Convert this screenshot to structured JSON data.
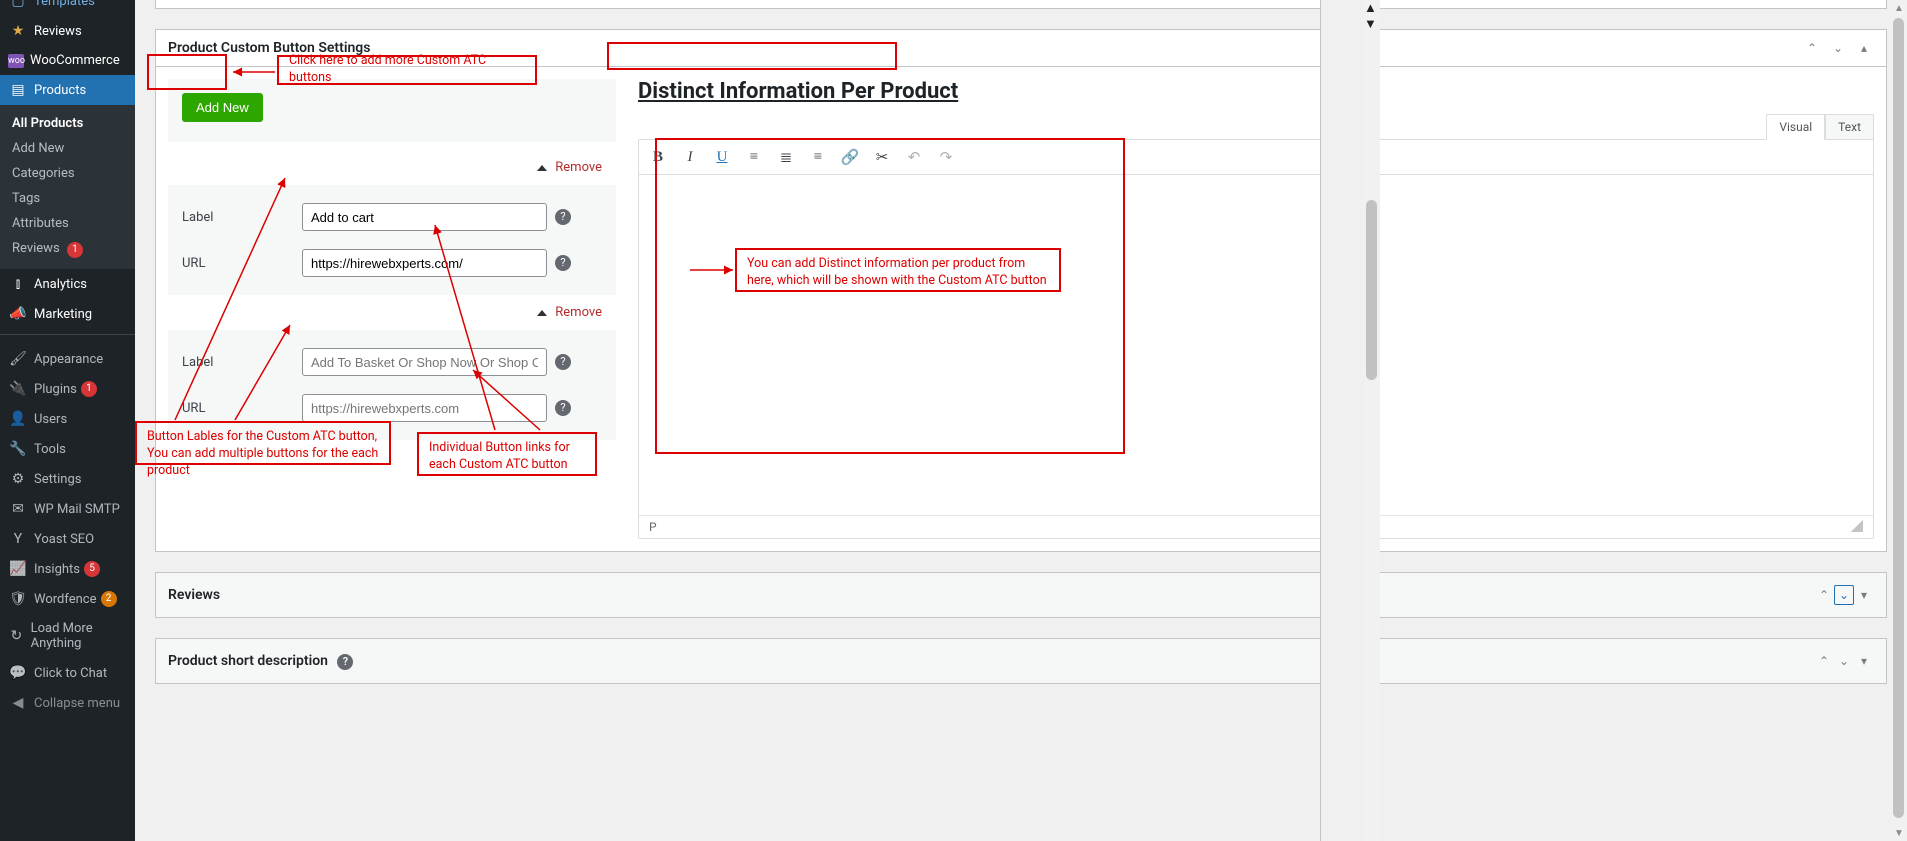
{
  "sidebar": {
    "items": [
      {
        "icon": "📄",
        "label": "Templates"
      },
      {
        "icon": "★",
        "label": "Reviews"
      },
      {
        "icon": "W",
        "label": "WooCommerce"
      },
      {
        "icon": "📦",
        "label": "Products"
      }
    ],
    "submenu": [
      {
        "label": "All Products"
      },
      {
        "label": "Add New"
      },
      {
        "label": "Categories"
      },
      {
        "label": "Tags"
      },
      {
        "label": "Attributes"
      },
      {
        "label": "Reviews",
        "badge": "1"
      }
    ],
    "analytics": {
      "icon": "📊",
      "label": "Analytics"
    },
    "marketing": {
      "icon": "📣",
      "label": "Marketing"
    },
    "appearance": {
      "icon": "🖌",
      "label": "Appearance"
    },
    "plugins": {
      "icon": "🔌",
      "label": "Plugins",
      "badge": "1"
    },
    "users": {
      "icon": "👤",
      "label": "Users"
    },
    "tools": {
      "icon": "🔧",
      "label": "Tools"
    },
    "settings": {
      "icon": "⚙",
      "label": "Settings"
    },
    "wpmailsmtp": {
      "icon": "✉",
      "label": "WP Mail SMTP"
    },
    "yoast": {
      "icon": "Y",
      "label": "Yoast SEO"
    },
    "insights": {
      "icon": "📈",
      "label": "Insights",
      "badge": "5"
    },
    "wordfence": {
      "icon": "🛡",
      "label": "Wordfence",
      "badge": "2"
    },
    "loadmore": {
      "icon": "↻",
      "label": "Load More Anything"
    },
    "chat": {
      "icon": "💬",
      "label": "Click to Chat"
    },
    "collapse": {
      "icon": "◀",
      "label": "Collapse menu"
    }
  },
  "panel": {
    "title": "Product Custom Button Settings",
    "add_new_label": "Add New",
    "remove_label": "Remove",
    "label_field": "Label",
    "url_field": "URL",
    "button1": {
      "label_value": "Add to cart",
      "url_value": "https://hirewebxperts.com/"
    },
    "button2": {
      "label_placeholder": "Add To Basket Or Shop Now Or Shop On Amazon",
      "url_placeholder": "https://hirewebxperts.com"
    }
  },
  "editor": {
    "heading": "Distinct Information Per Product",
    "tabs": {
      "visual": "Visual",
      "text": "Text"
    },
    "status_path": "P"
  },
  "reviews_panel": {
    "title": "Reviews"
  },
  "short_desc_panel": {
    "title": "Product short description"
  },
  "annotations": {
    "add_new_hint": "Click here to add more Custom ATC buttons",
    "labels_hint": "Button Lables for the Custom ATC button, You can add multiple buttons for the each product",
    "links_hint": "Individual Button links for each Custom ATC button",
    "distinct_hint": "You can add Distinct information per product from here, which will be shown with the Custom ATC button"
  }
}
